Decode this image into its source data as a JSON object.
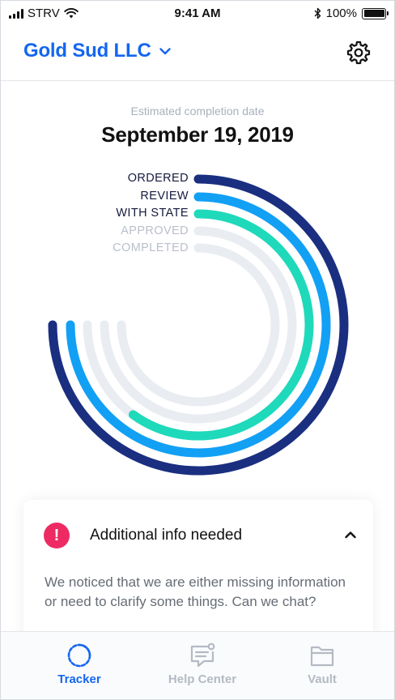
{
  "status_bar": {
    "carrier": "STRV",
    "time": "9:41 AM",
    "battery": "100%",
    "battery_level": 1.0
  },
  "header": {
    "company_name": "Gold Sud LLC",
    "dropdown_icon": "chevron-down-icon",
    "settings_icon": "gear-icon"
  },
  "estimate": {
    "label": "Estimated completion date",
    "date": "September 19, 2019"
  },
  "progress": {
    "stages": [
      {
        "label": "ORDERED",
        "status": "complete",
        "color": "#1a2f80",
        "fraction": 0.75
      },
      {
        "label": "REVIEW",
        "status": "complete",
        "color": "#12a0f5",
        "fraction": 0.75
      },
      {
        "label": "WITH STATE",
        "status": "in-progress",
        "color": "#1fd9bb",
        "fraction": 0.6
      },
      {
        "label": "APPROVED",
        "status": "pending",
        "color": "#e9ecf1",
        "fraction": 0
      },
      {
        "label": "COMPLETED",
        "status": "pending",
        "color": "#e9ecf1",
        "fraction": 0
      }
    ],
    "track_color": "#e9ecf1"
  },
  "alert": {
    "icon": "exclamation-icon",
    "icon_glyph": "!",
    "title": "Additional info needed",
    "body": "We noticed that we are either missing information or need to clarify some things. Can we chat?",
    "color": "#ee2a63"
  },
  "tabs": [
    {
      "label": "Tracker",
      "icon": "tracker-icon",
      "active": true
    },
    {
      "label": "Help Center",
      "icon": "chat-icon",
      "active": false
    },
    {
      "label": "Vault",
      "icon": "folder-icon",
      "active": false
    }
  ],
  "colors": {
    "accent": "#1366f0",
    "inactive": "#b4bac4"
  }
}
